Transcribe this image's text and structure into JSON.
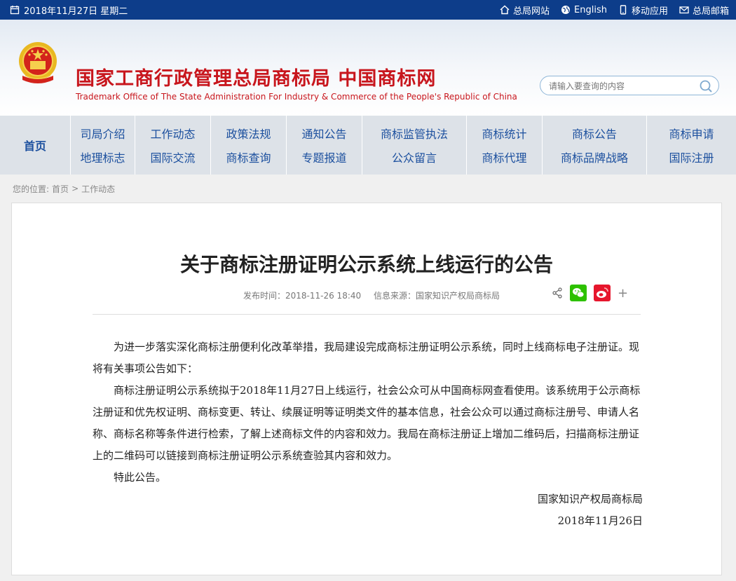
{
  "topbar": {
    "date": "2018年11月27日 星期二",
    "links": [
      {
        "label": "总局网站",
        "icon": "home-icon"
      },
      {
        "label": "English",
        "icon": "globe-icon"
      },
      {
        "label": "移动应用",
        "icon": "mobile-icon"
      },
      {
        "label": "总局邮箱",
        "icon": "mail-icon"
      }
    ]
  },
  "header": {
    "title_cn": "国家工商行政管理总局商标局 中国商标网",
    "title_en": "Trademark Office of The State Administration For Industry & Commerce of the People's Republic of China",
    "search_placeholder": "请输入要查询的内容"
  },
  "nav": {
    "home": "首页",
    "cols": [
      [
        "司局介绍",
        "地理标志"
      ],
      [
        "工作动态",
        "国际交流"
      ],
      [
        "政策法规",
        "商标查询"
      ],
      [
        "通知公告",
        "专题报道"
      ],
      [
        "商标监管执法",
        "公众留言"
      ],
      [
        "商标统计",
        "商标代理"
      ],
      [
        "商标公告",
        "商标品牌战略"
      ],
      [
        "商标申请",
        "国际注册"
      ]
    ]
  },
  "breadcrumb": {
    "label": "您的位置:",
    "home": "首页",
    "sep": ">",
    "current": "工作动态"
  },
  "article": {
    "title": "关于商标注册证明公示系统上线运行的公告",
    "published": "发布时间：2018-11-26 18:40",
    "source": "信息来源：国家知识产权局商标局",
    "paragraphs": [
      "为进一步落实深化商标注册便利化改革举措，我局建设完成商标注册证明公示系统，同时上线商标电子注册证。现将有关事项公告如下：",
      "商标注册证明公示系统拟于2018年11月27日上线运行，社会公众可从中国商标网查看使用。该系统用于公示商标注册证和优先权证明、商标变更、转让、续展证明等证明类文件的基本信息，社会公众可以通过商标注册号、申请人名称、商标名称等条件进行检索，了解上述商标文件的内容和效力。我局在商标注册证上增加二维码后，扫描商标注册证上的二维码可以链接到商标注册证明公示系统查验其内容和效力。",
      "特此公告。"
    ],
    "signature": "国家知识产权局商标局",
    "sign_date": "2018年11月26日",
    "share_plus": "+"
  },
  "colors": {
    "topbar": "#0d3d8a",
    "nav_text": "#1b4f9e",
    "brand_red": "#c8161d",
    "wechat": "#2dc100",
    "weibo": "#e6162d"
  }
}
